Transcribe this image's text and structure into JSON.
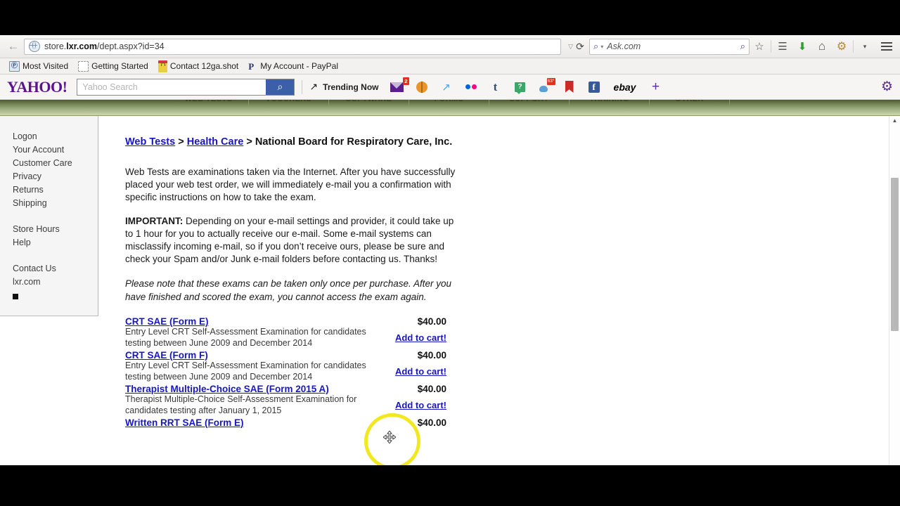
{
  "browser": {
    "back_label": "←",
    "url_prefix": "store.",
    "url_domain": "lxr.com",
    "url_path": "/dept.aspx?id=34",
    "url_dropdown_caret": "▽",
    "reload_label": "⟳",
    "search_engine_label": "Ask.com",
    "search_caret": "▾",
    "search_mag": "⌕",
    "search_go": "⌕",
    "toolbar_icons": [
      {
        "name": "bookmark-star-icon",
        "glyph": "☆"
      },
      {
        "name": "reading-list-icon",
        "glyph": "☰"
      },
      {
        "name": "downloads-icon",
        "glyph": "⬇"
      },
      {
        "name": "home-icon",
        "glyph": "⌂"
      },
      {
        "name": "addon-gear-icon",
        "glyph": "⚙"
      },
      {
        "name": "overflow-caret-icon",
        "glyph": "▾"
      }
    ],
    "bookmarks": [
      {
        "label": "Most Visited",
        "icon": "most-visited-icon",
        "glyph": "Ⓟ"
      },
      {
        "label": "Getting Started",
        "icon": "getting-started-icon",
        "glyph": ""
      },
      {
        "label": "Contact 12ga.shot",
        "icon": "shopping-bag-icon",
        "glyph": ""
      },
      {
        "label": "My Account - PayPal",
        "icon": "paypal-icon",
        "glyph": "P"
      }
    ]
  },
  "yahoo_toolbar": {
    "logo": "YAHOO!",
    "search_placeholder": "Yahoo Search",
    "search_value": "",
    "search_button_glyph": "⌕",
    "trending_label": "Trending Now",
    "trending_icon_glyph": "↗",
    "icons": [
      {
        "name": "yahoo-mail-icon",
        "badge": "2"
      },
      {
        "name": "yahoo-sports-icon",
        "badge": ""
      },
      {
        "name": "yahoo-finance-icon",
        "badge": "",
        "glyph": "↗"
      },
      {
        "name": "flickr-icon",
        "badge": ""
      },
      {
        "name": "tumblr-icon",
        "badge": "",
        "glyph": "t"
      },
      {
        "name": "yahoo-answers-icon",
        "badge": "",
        "glyph": "?"
      },
      {
        "name": "yahoo-weather-icon",
        "badge": "63°"
      },
      {
        "name": "yahoo-bookmarks-icon",
        "badge": ""
      },
      {
        "name": "facebook-icon",
        "badge": "",
        "glyph": "f"
      },
      {
        "name": "ebay-icon",
        "badge": "",
        "glyph": "ebay"
      },
      {
        "name": "add-app-icon",
        "badge": "",
        "glyph": "+"
      }
    ],
    "settings_glyph": "⚙"
  },
  "site_nav": {
    "items": [
      "WEB TESTS",
      "VOUCHERS",
      "SOFTWARE",
      "FORMS",
      "SUPPORT",
      "TRAINING",
      "OTHER"
    ]
  },
  "sidebar": {
    "group1": [
      "Logon",
      "Your Account",
      "Customer Care",
      "Privacy",
      "Returns",
      "Shipping"
    ],
    "group2": [
      "Store Hours",
      "Help"
    ],
    "group3": [
      "Contact Us",
      "lxr.com"
    ]
  },
  "content": {
    "breadcrumb": {
      "link1": "Web Tests",
      "sep1": " > ",
      "link2": "Health Care",
      "sep2": " > ",
      "current": "National Board for Respiratory Care, Inc."
    },
    "intro_paragraph": "Web Tests are examinations taken via the Internet. After you have successfully placed your web test order, we will immediately e-mail you a confirmation with specific instructions on how to take the exam.",
    "important_label": "IMPORTANT:",
    "important_paragraph": " Depending on your e-mail settings and provider, it could take up to 1 hour for you to actually receive our e-mail. Some e-mail systems can misclassify incoming e-mail, so if you don’t receive ours, please be sure and check your Spam and/or Junk e-mail folders before contacting us. Thanks!",
    "note_italic": "Please note that these exams can be taken only once per purchase. After you have finished and scored the exam, you cannot access the exam again.",
    "add_to_cart_label": "Add to cart!",
    "products": [
      {
        "title": "CRT SAE (Form E)",
        "price": "$40.00",
        "description": "Entry Level CRT Self-Assessment Examination for candidates testing between June 2009 and December 2014"
      },
      {
        "title": "CRT SAE (Form F)",
        "price": "$40.00",
        "description": "Entry Level CRT Self-Assessment Examination for candidates testing between June 2009 and December 2014"
      },
      {
        "title": "Therapist Multiple-Choice SAE (Form 2015 A)",
        "price": "$40.00",
        "description": "Therapist Multiple-Choice Self-Assessment Examination for candidates testing after January 1, 2015"
      },
      {
        "title": "Written RRT SAE (Form E)",
        "price": "$40.00",
        "description": ""
      }
    ]
  },
  "scrollbar": {
    "up_arrow": "▲"
  },
  "colors": {
    "link": "#1616c4",
    "nav_green_dark": "#4a5a33",
    "nav_green_light": "#cdd6b6",
    "yahoo_purple": "#5c138e",
    "yahoo_search_blue": "#3b5fa8",
    "cursor_highlight": "#f2e81f"
  }
}
